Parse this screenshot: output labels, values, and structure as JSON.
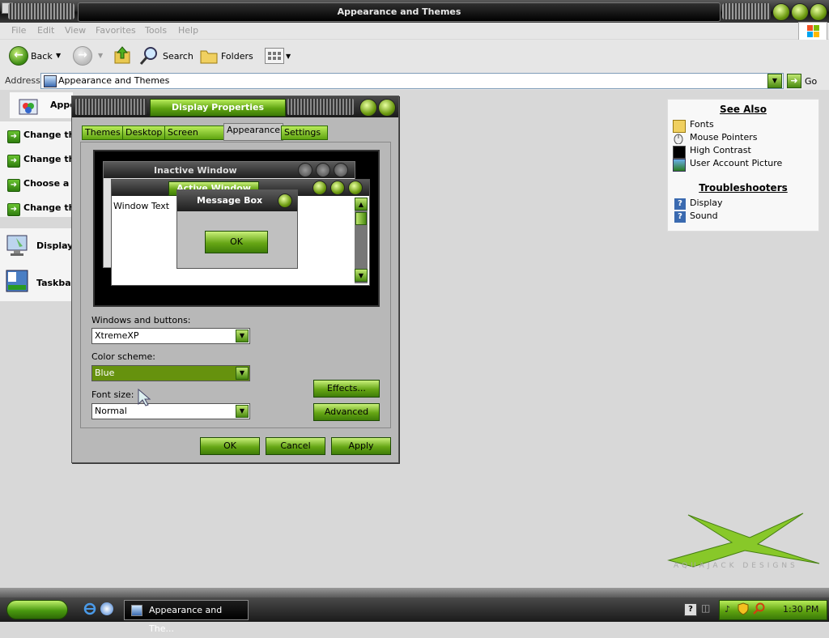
{
  "window": {
    "title": "Appearance and Themes"
  },
  "menu": {
    "items": [
      "File",
      "Edit",
      "View",
      "Favorites",
      "Tools",
      "Help"
    ]
  },
  "toolbar": {
    "back": "Back",
    "search": "Search",
    "folders": "Folders"
  },
  "address": {
    "label": "Address",
    "value": "Appearance and Themes",
    "go": "Go"
  },
  "left_panel": {
    "header": "Appe",
    "tasks": [
      "Change th",
      "Change th",
      "Choose a s",
      "Change th"
    ],
    "items": [
      "Display",
      "Taskbar"
    ]
  },
  "see_also": {
    "title": "See Also",
    "links": [
      "Fonts",
      "Mouse Pointers",
      "High Contrast",
      "User Account Picture"
    ],
    "troubleshooters_title": "Troubleshooters",
    "troubleshooters": [
      "Display",
      "Sound"
    ]
  },
  "dialog": {
    "title": "Display Properties",
    "tabs": [
      "Themes",
      "Desktop",
      "Screen Saver",
      "Appearance",
      "Settings"
    ],
    "active_tab": "Appearance",
    "preview": {
      "inactive_title": "Inactive Window",
      "active_title": "Active Window",
      "window_text": "Window Text",
      "message_box_title": "Message Box",
      "ok": "OK"
    },
    "windows_buttons_label": "Windows and buttons:",
    "windows_buttons_value": "XtremeXP",
    "color_scheme_label": "Color scheme:",
    "color_scheme_value": "Blue",
    "font_size_label": "Font size:",
    "font_size_value": "Normal",
    "effects": "Effects...",
    "advanced": "Advanced",
    "ok": "OK",
    "cancel": "Cancel",
    "apply": "Apply"
  },
  "watermark": "AQUAJACK DESIGNS",
  "taskbar": {
    "task": "Appearance and The...",
    "clock": "1:30 PM"
  },
  "colors": {
    "accent_green": "#5fa410",
    "dark": "#1a1a1a"
  }
}
